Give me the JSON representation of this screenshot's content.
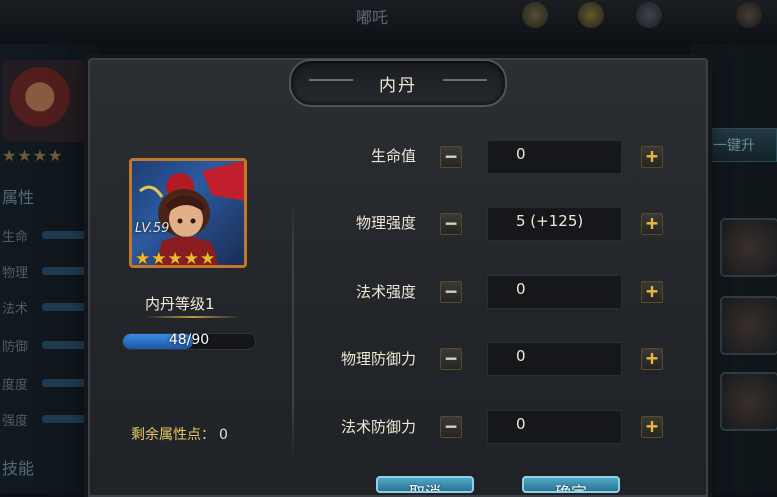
{
  "background": {
    "title": "嘟吒",
    "attributes_heading": "属性",
    "attributes": [
      "生命",
      "物理",
      "法术",
      "防御",
      "度度",
      "强度"
    ],
    "skills_heading": "技能",
    "right_button_label": "一键升"
  },
  "dialog": {
    "title": "内丹",
    "hero": {
      "level_label": "LV.59",
      "stars": "★★★★★",
      "star_count": 5
    },
    "neidan_level": "内丹等级1",
    "exp": {
      "text": "48/90",
      "current": 48,
      "max": 90
    },
    "remaining_points": {
      "label": "剩余属性点：",
      "value": "0"
    },
    "stats": [
      {
        "label": "生命值",
        "value": "0"
      },
      {
        "label": "物理强度",
        "value": "5 (+125)"
      },
      {
        "label": "法术强度",
        "value": "0"
      },
      {
        "label": "物理防御力",
        "value": "0"
      },
      {
        "label": "法术防御力",
        "value": "0"
      }
    ],
    "buttons": {
      "cancel": "取消",
      "confirm": "确定"
    },
    "minus_symbol": "−",
    "plus_symbol": "+"
  },
  "colors": {
    "accent_gold": "#e8b93a",
    "exp_bar": "#3b8be0",
    "button": "#4fa9c8"
  }
}
